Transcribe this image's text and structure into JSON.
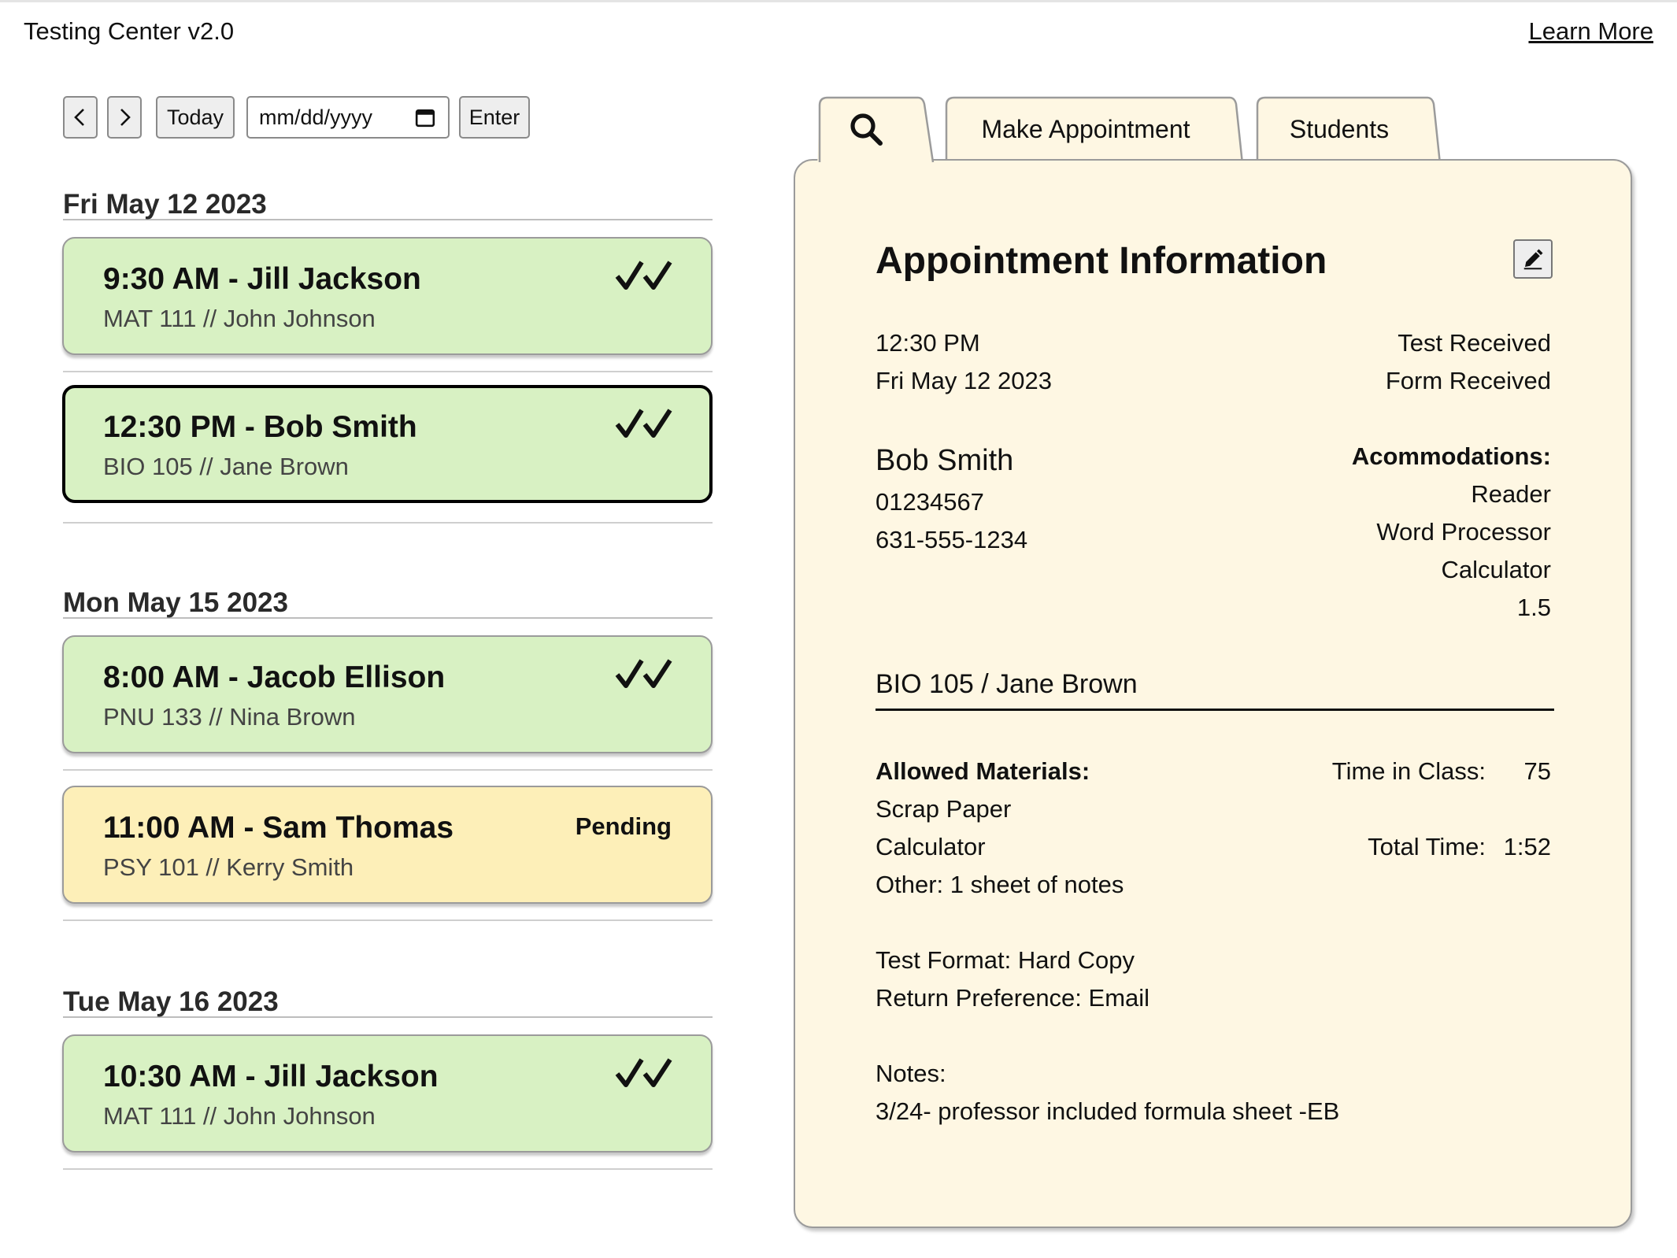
{
  "app": {
    "title": "Testing Center v2.0",
    "learn_more": "Learn More"
  },
  "toolbar": {
    "prev_icon": "chevron-left-icon",
    "next_icon": "chevron-right-icon",
    "today_label": "Today",
    "date_placeholder": "mm/dd/yyyy",
    "calendar_icon": "calendar-icon",
    "enter_label": "Enter"
  },
  "days": [
    {
      "header": "Fri May 12 2023",
      "appointments": [
        {
          "title": "9:30 AM - Jill Jackson",
          "subtitle": "MAT 111 // John Johnson",
          "status": "double-check-icon",
          "color": "#d8f1c3"
        },
        {
          "title": "12:30 PM - Bob Smith",
          "subtitle": "BIO 105 // Jane Brown",
          "status": "double-check-icon",
          "color": "#d8f1c3",
          "selected": true
        }
      ]
    },
    {
      "header": "Mon May 15 2023",
      "appointments": [
        {
          "title": "8:00 AM - Jacob Ellison",
          "subtitle": "PNU 133 // Nina Brown",
          "status": "double-check-icon",
          "color": "#d8f1c3"
        },
        {
          "title": "11:00 AM - Sam Thomas",
          "subtitle": "PSY 101 // Kerry Smith",
          "status": "Pending",
          "color": "#fdefb8"
        }
      ]
    },
    {
      "header": "Tue May 16 2023",
      "appointments": [
        {
          "title": "10:30 AM - Jill Jackson",
          "subtitle": "MAT 111 // John Johnson",
          "status": "double-check-icon",
          "color": "#d8f1c3"
        }
      ]
    }
  ],
  "tabs": [
    {
      "icon": "search-icon",
      "active": true
    },
    {
      "label": "Make Appointment"
    },
    {
      "label": "Students"
    }
  ],
  "panel": {
    "title": "Appointment Information",
    "edit_icon": "pencil-icon",
    "time": "12:30 PM",
    "date": "Fri May 12 2023",
    "test_received": "Test Received",
    "form_received": "Form Received",
    "student_name": "Bob Smith",
    "student_id": "01234567",
    "phone": "631-555-1234",
    "accommodations_label": "Acommodations:",
    "accommodations": [
      "Reader",
      "Word Processor",
      "Calculator",
      "1.5"
    ],
    "course": "BIO 105 / Jane Brown",
    "allowed_label": "Allowed Materials:",
    "allowed": [
      "Scrap Paper",
      "Calculator",
      "Other: 1 sheet of notes"
    ],
    "time_in_class_label": "Time in Class:",
    "time_in_class": "75",
    "total_time_label": "Total Time:",
    "total_time": "1:52",
    "test_format": "Test Format: Hard Copy",
    "return_pref": "Return Preference: Email",
    "notes_label": "Notes:",
    "notes": "3/24- professor included formula sheet -EB"
  },
  "colors": {
    "panel_bg": "#fef7e3",
    "confirmed": "#d8f1c3",
    "pending": "#fdefb8"
  }
}
